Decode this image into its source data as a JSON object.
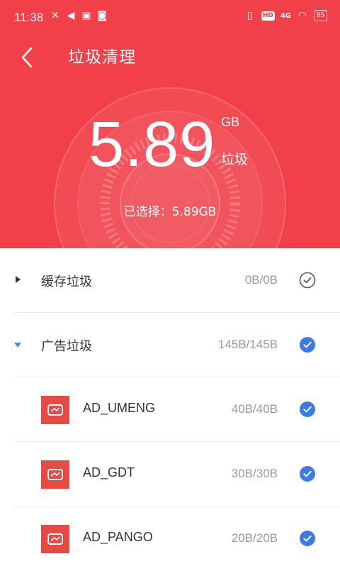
{
  "status_bar": {
    "time": "11:38",
    "battery": "85",
    "network": "4G"
  },
  "header": {
    "title": "垃圾清理",
    "amount": "5.89",
    "unit": "GB",
    "unit_label": "垃圾",
    "selected_text": "已选择：5.89GB"
  },
  "categories": [
    {
      "label": "缓存垃圾",
      "size": "0B/0B",
      "expanded": false,
      "checked": false
    },
    {
      "label": "广告垃圾",
      "size": "145B/145B",
      "expanded": true,
      "checked": true
    }
  ],
  "ad_items": [
    {
      "label": "AD_UMENG",
      "size": "40B/40B",
      "checked": true
    },
    {
      "label": "AD_GDT",
      "size": "30B/30B",
      "checked": true
    },
    {
      "label": "AD_PANGO",
      "size": "20B/20B",
      "checked": true
    }
  ],
  "colors": {
    "header_bg": "#f1404a",
    "check_blue": "#3c7ae6",
    "app_icon": "#e54a45"
  }
}
